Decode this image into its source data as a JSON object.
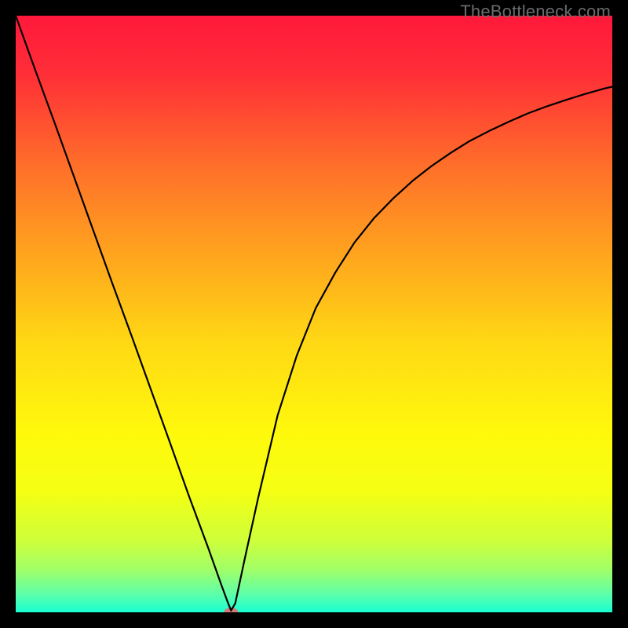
{
  "watermark": "TheBottleneck.com",
  "chart_data": {
    "type": "line",
    "title": "",
    "xlabel": "",
    "ylabel": "",
    "xlim": [
      0,
      100
    ],
    "ylim": [
      0,
      100
    ],
    "background_gradient": {
      "stops": [
        {
          "offset": 0.0,
          "color": "#ff183b"
        },
        {
          "offset": 0.1,
          "color": "#ff2f37"
        },
        {
          "offset": 0.25,
          "color": "#ff6e2a"
        },
        {
          "offset": 0.4,
          "color": "#ffa41e"
        },
        {
          "offset": 0.55,
          "color": "#ffd914"
        },
        {
          "offset": 0.7,
          "color": "#fff90c"
        },
        {
          "offset": 0.8,
          "color": "#f4ff14"
        },
        {
          "offset": 0.88,
          "color": "#ceff3a"
        },
        {
          "offset": 0.93,
          "color": "#9fff6a"
        },
        {
          "offset": 0.97,
          "color": "#5dffaa"
        },
        {
          "offset": 1.0,
          "color": "#18ffd3"
        }
      ]
    },
    "series": [
      {
        "name": "bottleneck-curve",
        "color": "#000000",
        "x": [
          0.0,
          3.2,
          6.5,
          9.7,
          12.9,
          16.1,
          19.4,
          22.6,
          25.8,
          29.0,
          32.3,
          34.5,
          35.5,
          36.1,
          36.8,
          38.4,
          40.6,
          43.9,
          47.1,
          50.3,
          53.6,
          56.8,
          60.0,
          63.2,
          66.5,
          69.7,
          72.9,
          76.1,
          79.4,
          82.6,
          85.8,
          89.0,
          92.3,
          95.5,
          98.7,
          100.0
        ],
        "y": [
          100.0,
          91.1,
          82.1,
          73.2,
          64.3,
          55.4,
          46.4,
          37.5,
          28.6,
          19.6,
          10.7,
          4.5,
          1.8,
          0.3,
          1.5,
          9.0,
          19.0,
          33.0,
          43.0,
          51.0,
          57.0,
          62.0,
          66.0,
          69.3,
          72.3,
          74.8,
          77.0,
          79.0,
          80.7,
          82.2,
          83.6,
          84.8,
          85.9,
          86.9,
          87.8,
          88.1
        ]
      }
    ],
    "marker": {
      "name": "bottleneck-point",
      "x": 36.1,
      "y": 0.0,
      "color": "#d27a7a",
      "rx": 9,
      "ry": 6
    }
  }
}
